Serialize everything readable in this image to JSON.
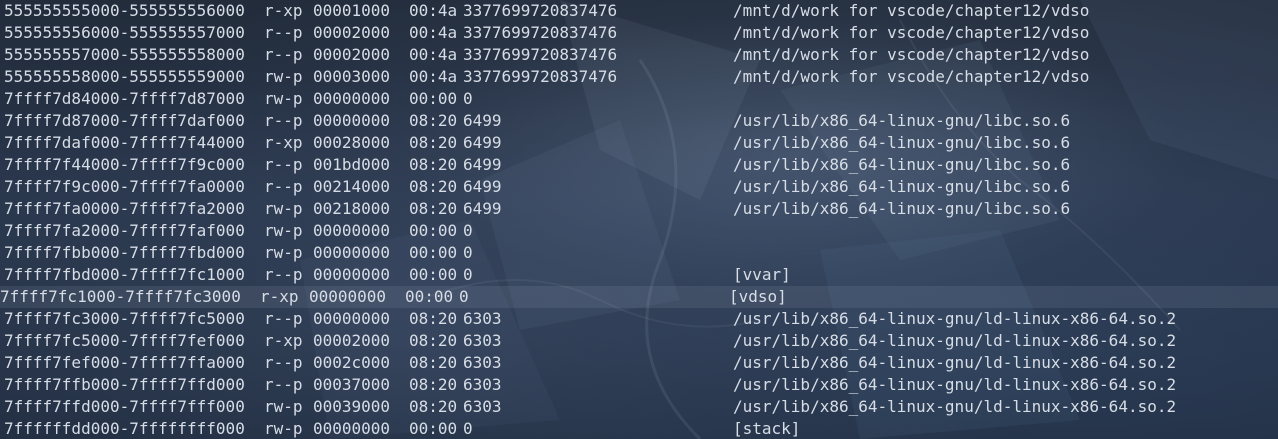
{
  "terminal": {
    "lines": [
      {
        "range": "555555555000-555555556000",
        "perms": "r-xp",
        "offset": "00001000",
        "dev": "00:4a",
        "inode": "3377699720837476",
        "path": "/mnt/d/work for vscode/chapter12/vdso"
      },
      {
        "range": "555555556000-555555557000",
        "perms": "r--p",
        "offset": "00002000",
        "dev": "00:4a",
        "inode": "3377699720837476",
        "path": "/mnt/d/work for vscode/chapter12/vdso"
      },
      {
        "range": "555555557000-555555558000",
        "perms": "r--p",
        "offset": "00002000",
        "dev": "00:4a",
        "inode": "3377699720837476",
        "path": "/mnt/d/work for vscode/chapter12/vdso"
      },
      {
        "range": "555555558000-555555559000",
        "perms": "rw-p",
        "offset": "00003000",
        "dev": "00:4a",
        "inode": "3377699720837476",
        "path": "/mnt/d/work for vscode/chapter12/vdso"
      },
      {
        "range": "7ffff7d84000-7ffff7d87000",
        "perms": "rw-p",
        "offset": "00000000",
        "dev": "00:00",
        "inode": "0",
        "path": ""
      },
      {
        "range": "7ffff7d87000-7ffff7daf000",
        "perms": "r--p",
        "offset": "00000000",
        "dev": "08:20",
        "inode": "6499",
        "path": "/usr/lib/x86_64-linux-gnu/libc.so.6"
      },
      {
        "range": "7ffff7daf000-7ffff7f44000",
        "perms": "r-xp",
        "offset": "00028000",
        "dev": "08:20",
        "inode": "6499",
        "path": "/usr/lib/x86_64-linux-gnu/libc.so.6"
      },
      {
        "range": "7ffff7f44000-7ffff7f9c000",
        "perms": "r--p",
        "offset": "001bd000",
        "dev": "08:20",
        "inode": "6499",
        "path": "/usr/lib/x86_64-linux-gnu/libc.so.6"
      },
      {
        "range": "7ffff7f9c000-7ffff7fa0000",
        "perms": "r--p",
        "offset": "00214000",
        "dev": "08:20",
        "inode": "6499",
        "path": "/usr/lib/x86_64-linux-gnu/libc.so.6"
      },
      {
        "range": "7ffff7fa0000-7ffff7fa2000",
        "perms": "rw-p",
        "offset": "00218000",
        "dev": "08:20",
        "inode": "6499",
        "path": "/usr/lib/x86_64-linux-gnu/libc.so.6"
      },
      {
        "range": "7ffff7fa2000-7ffff7faf000",
        "perms": "rw-p",
        "offset": "00000000",
        "dev": "00:00",
        "inode": "0",
        "path": ""
      },
      {
        "range": "7ffff7fbb000-7ffff7fbd000",
        "perms": "rw-p",
        "offset": "00000000",
        "dev": "00:00",
        "inode": "0",
        "path": ""
      },
      {
        "range": "7ffff7fbd000-7ffff7fc1000",
        "perms": "r--p",
        "offset": "00000000",
        "dev": "00:00",
        "inode": "0",
        "path": "[vvar]"
      },
      {
        "range": "7ffff7fc1000-7ffff7fc3000",
        "perms": "r-xp",
        "offset": "00000000",
        "dev": "00:00",
        "inode": "0",
        "path": "[vdso]",
        "highlight": true
      },
      {
        "range": "7ffff7fc3000-7ffff7fc5000",
        "perms": "r--p",
        "offset": "00000000",
        "dev": "08:20",
        "inode": "6303",
        "path": "/usr/lib/x86_64-linux-gnu/ld-linux-x86-64.so.2"
      },
      {
        "range": "7ffff7fc5000-7ffff7fef000",
        "perms": "r-xp",
        "offset": "00002000",
        "dev": "08:20",
        "inode": "6303",
        "path": "/usr/lib/x86_64-linux-gnu/ld-linux-x86-64.so.2"
      },
      {
        "range": "7ffff7fef000-7ffff7ffa000",
        "perms": "r--p",
        "offset": "0002c000",
        "dev": "08:20",
        "inode": "6303",
        "path": "/usr/lib/x86_64-linux-gnu/ld-linux-x86-64.so.2"
      },
      {
        "range": "7ffff7ffb000-7ffff7ffd000",
        "perms": "r--p",
        "offset": "00037000",
        "dev": "08:20",
        "inode": "6303",
        "path": "/usr/lib/x86_64-linux-gnu/ld-linux-x86-64.so.2"
      },
      {
        "range": "7ffff7ffd000-7ffff7fff000",
        "perms": "rw-p",
        "offset": "00039000",
        "dev": "08:20",
        "inode": "6303",
        "path": "/usr/lib/x86_64-linux-gnu/ld-linux-x86-64.so.2"
      },
      {
        "range": "7ffffffdd000-7ffffffff000",
        "perms": "rw-p",
        "offset": "00000000",
        "dev": "00:00",
        "inode": "0",
        "path": "[stack]"
      }
    ]
  }
}
